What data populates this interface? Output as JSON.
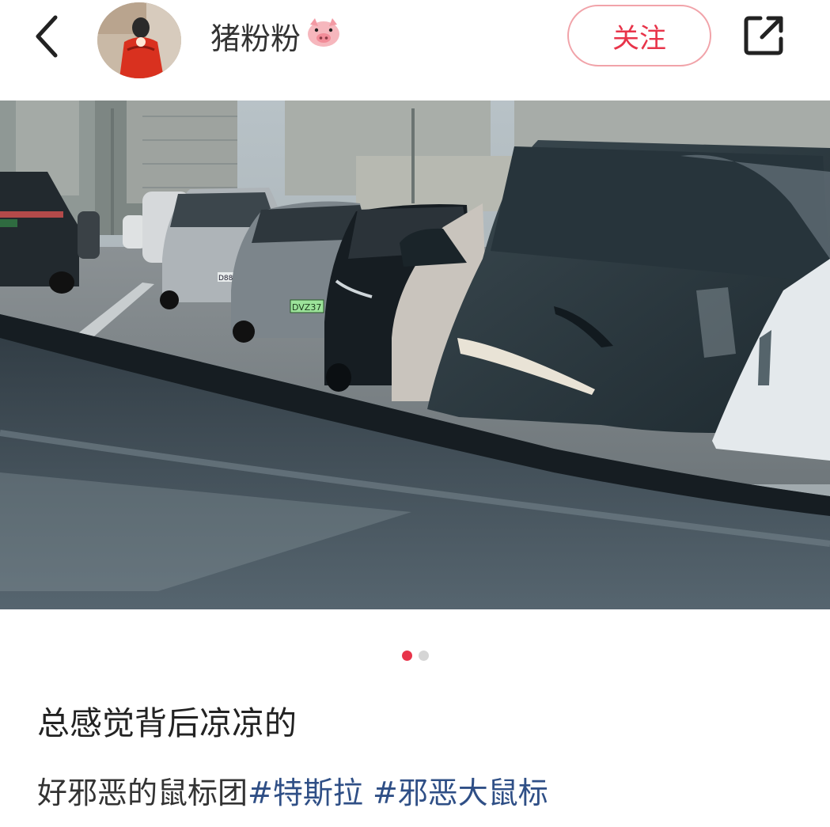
{
  "header": {
    "username": "猪粉粉",
    "username_emoji": "🐷",
    "follow_label": "关注",
    "back_icon": "chevron-left-icon",
    "share_icon": "share-icon"
  },
  "photo": {
    "description_icon": "photo",
    "plate_left": "D88",
    "plate_center": "DVZ37"
  },
  "carousel": {
    "total": 2,
    "active_index": 0
  },
  "post": {
    "title": "总感觉背后凉凉的",
    "body_text": "好邪恶的鼠标团",
    "hashtags": [
      "#特斯拉",
      "#邪恶大鼠标"
    ]
  },
  "colors": {
    "accent": "#e8344a",
    "hashtag": "#2f4f86",
    "follow_border": "#f1a3a9"
  }
}
